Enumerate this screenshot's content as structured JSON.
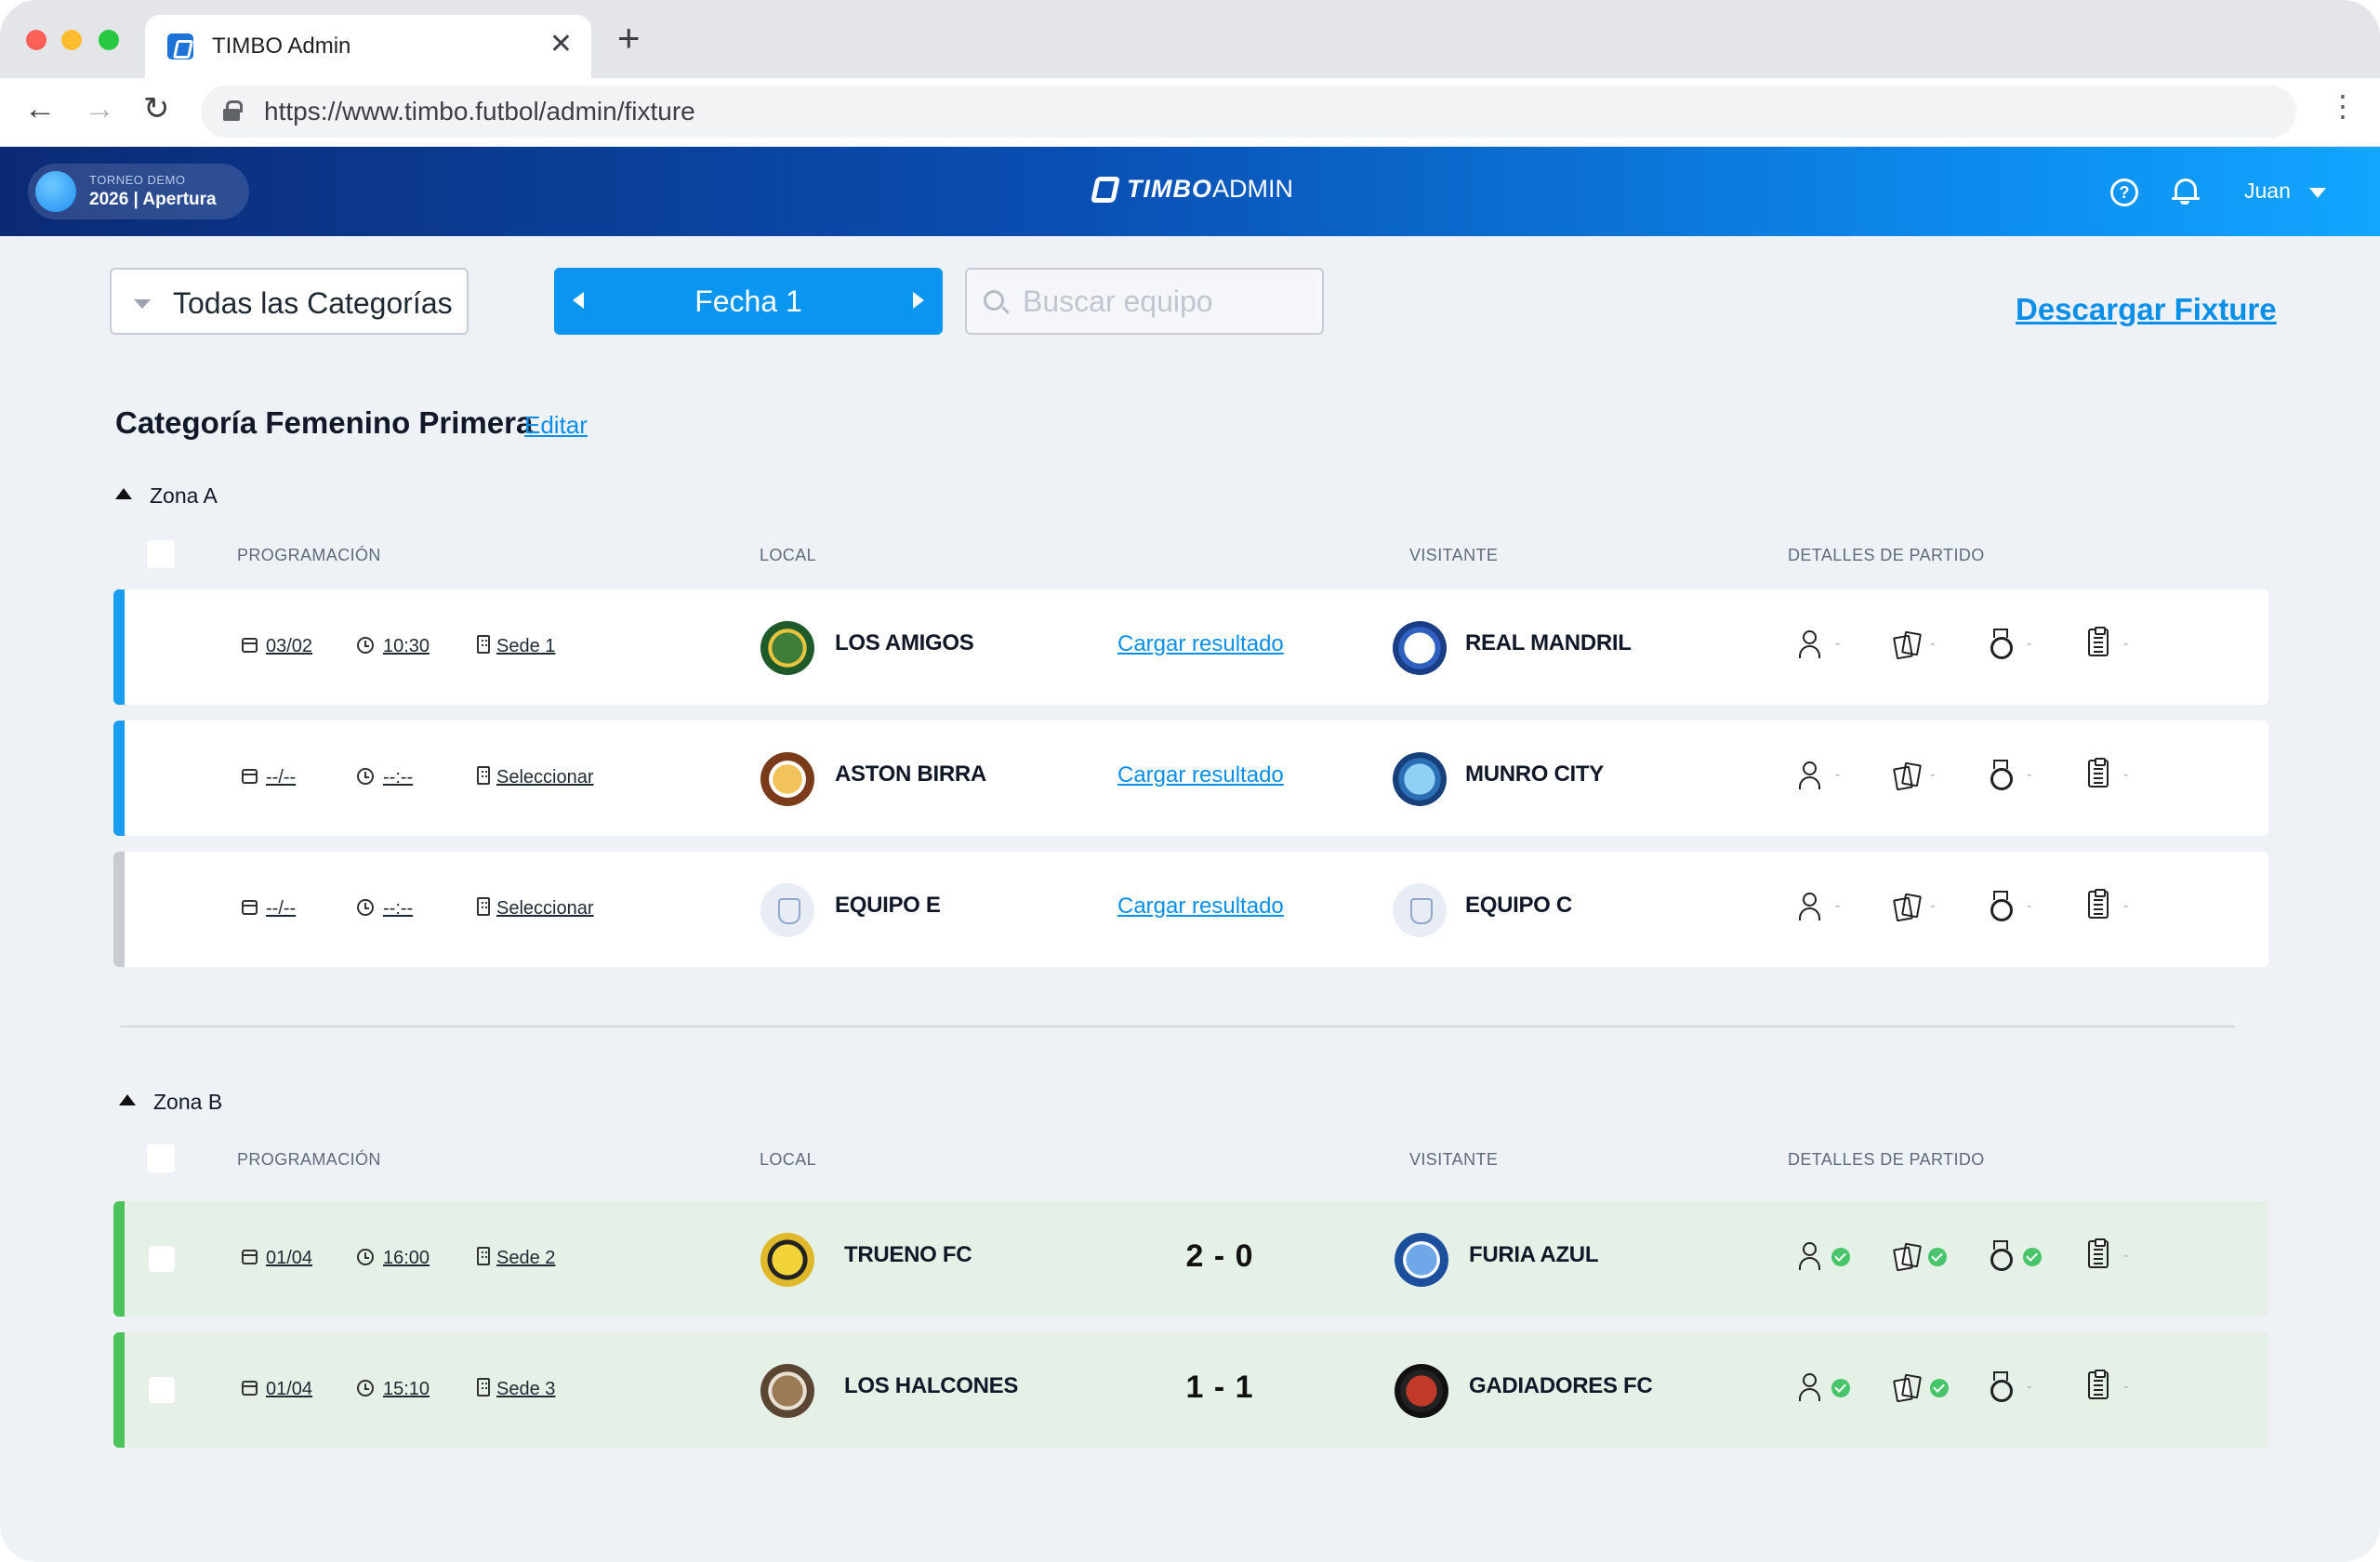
{
  "browser": {
    "tab_title": "TIMBO Admin",
    "url": "https://www.timbo.futbol/admin/fixture"
  },
  "header": {
    "tournament_label": "TORNEO DEMO",
    "tournament_name": "2026 | Apertura",
    "brand_strong": "TIMBO",
    "brand_light": "ADMIN",
    "user_name": "Juan"
  },
  "toolbar": {
    "category_select": "Todas las Categorías",
    "fecha_label": "Fecha 1",
    "search_placeholder": "Buscar equipo",
    "download_label": "Descargar Fixture"
  },
  "section": {
    "category_title": "Categoría Femenino Primera",
    "edit_label": "Editar"
  },
  "columns": {
    "programming": "PROGRAMACIÓN",
    "local": "LOCAL",
    "visitor": "VISITANTE",
    "details": "DETALLES DE PARTIDO"
  },
  "colors": {
    "accent": "#0a95f0",
    "bar_scheduled": "#1a9cf0",
    "bar_unscheduled": "#c8cbd0",
    "bar_played": "#4cc35a",
    "played_bg": "#e5f1e7"
  },
  "zones": [
    {
      "name": "Zona A",
      "matches": [
        {
          "date": "03/02",
          "time": "10:30",
          "venue": "Sede 1",
          "home": "LOS AMIGOS",
          "away": "REAL MANDRIL",
          "result": "Cargar resultado",
          "status_mark": "-"
        },
        {
          "date": "--/--",
          "time": "--:--",
          "venue": "Seleccionar",
          "home": "ASTON BIRRA",
          "away": "MUNRO CITY",
          "result": "Cargar resultado",
          "status_mark": "-"
        },
        {
          "date": "--/--",
          "time": "--:--",
          "venue": "Seleccionar",
          "home": "EQUIPO E",
          "away": "EQUIPO C",
          "result": "Cargar resultado",
          "status_mark": "-"
        }
      ]
    },
    {
      "name": "Zona B",
      "matches": [
        {
          "date": "01/04",
          "time": "16:00",
          "venue": "Sede 2",
          "home": "TRUENO FC",
          "away": "FURIA AZUL",
          "score": "2 - 0",
          "status_mark": "-"
        },
        {
          "date": "01/04",
          "time": "15:10",
          "venue": "Sede 3",
          "home": "LOS HALCONES",
          "away": "GADIADORES FC",
          "score": "1 - 1",
          "status_mark": "-"
        }
      ]
    }
  ]
}
